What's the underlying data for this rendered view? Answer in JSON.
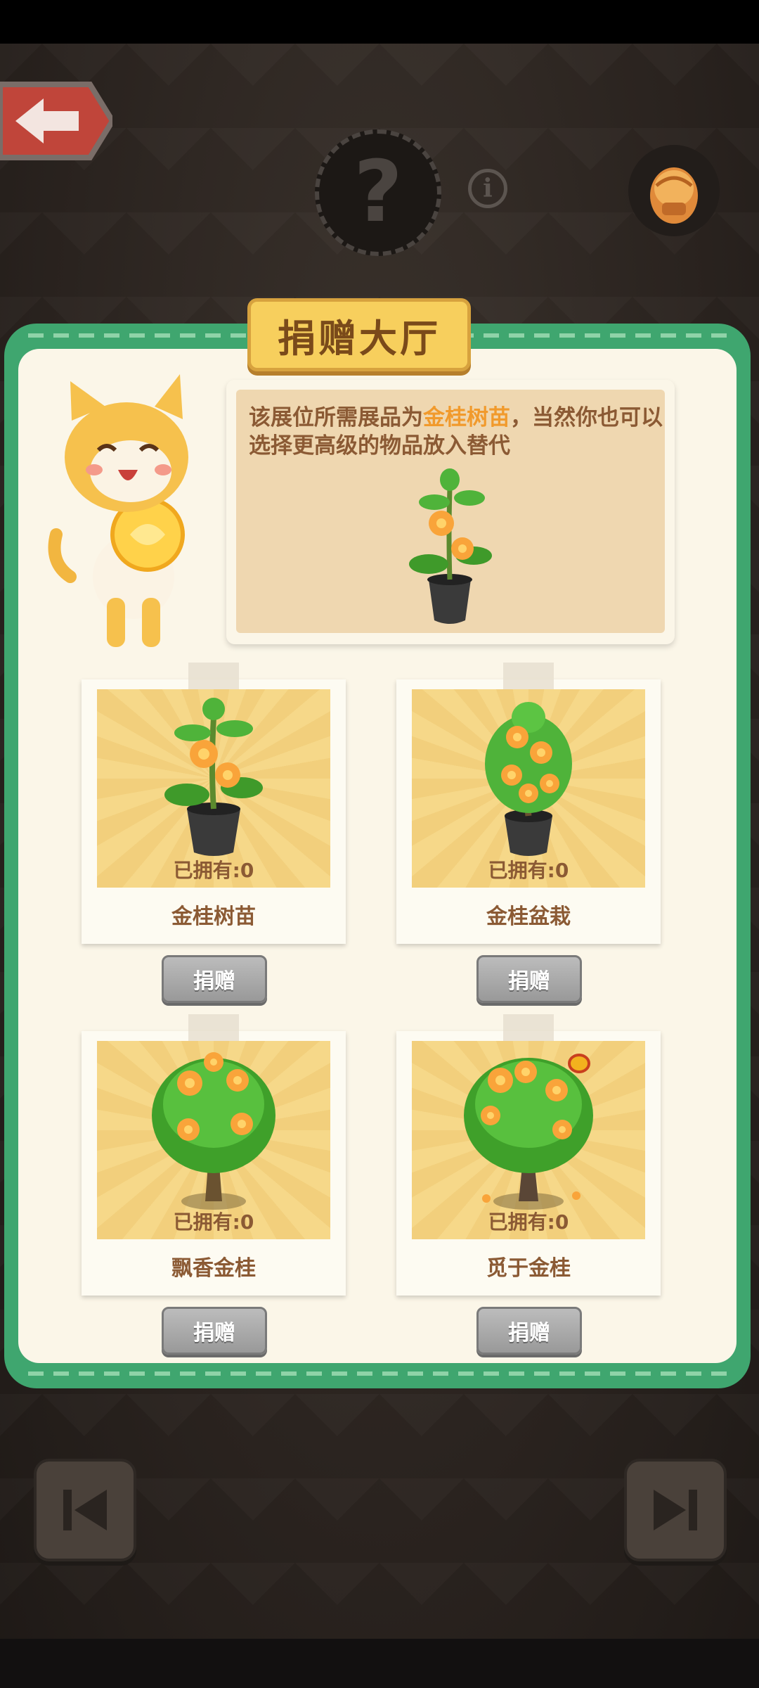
{
  "panel": {
    "title": "捐赠大厅",
    "requirement": {
      "text_before": "该展位所需展品为",
      "highlight": "金桂树苗",
      "text_after": "，当然你也可以选择更高级的物品放入替代"
    }
  },
  "items": [
    {
      "name": "金桂树苗",
      "owned": "已拥有:0",
      "button": "捐赠",
      "icon": "potted-sapling-icon"
    },
    {
      "name": "金桂盆栽",
      "owned": "已拥有:0",
      "button": "捐赠",
      "icon": "potted-bonsai-icon"
    },
    {
      "name": "飘香金桂",
      "owned": "已拥有:0",
      "button": "捐赠",
      "icon": "osmanthus-tree-icon"
    },
    {
      "name": "觅于金桂",
      "owned": "已拥有:0",
      "button": "捐赠",
      "icon": "golden-osmanthus-tree-icon"
    }
  ],
  "colors": {
    "panel_border": "#3fa66f",
    "panel_bg": "#fbf6e8",
    "title_bg": "#f7cf5d",
    "text_brown": "#8b5a34",
    "highlight": "#f19a2c",
    "button_gray": "#a8a8a8"
  },
  "icons": {
    "back": "back-arrow-icon",
    "mystery": "question-mark-icon",
    "info": "info-icon",
    "bag": "bag-icon",
    "prev": "skip-previous-icon",
    "next": "skip-next-icon"
  }
}
